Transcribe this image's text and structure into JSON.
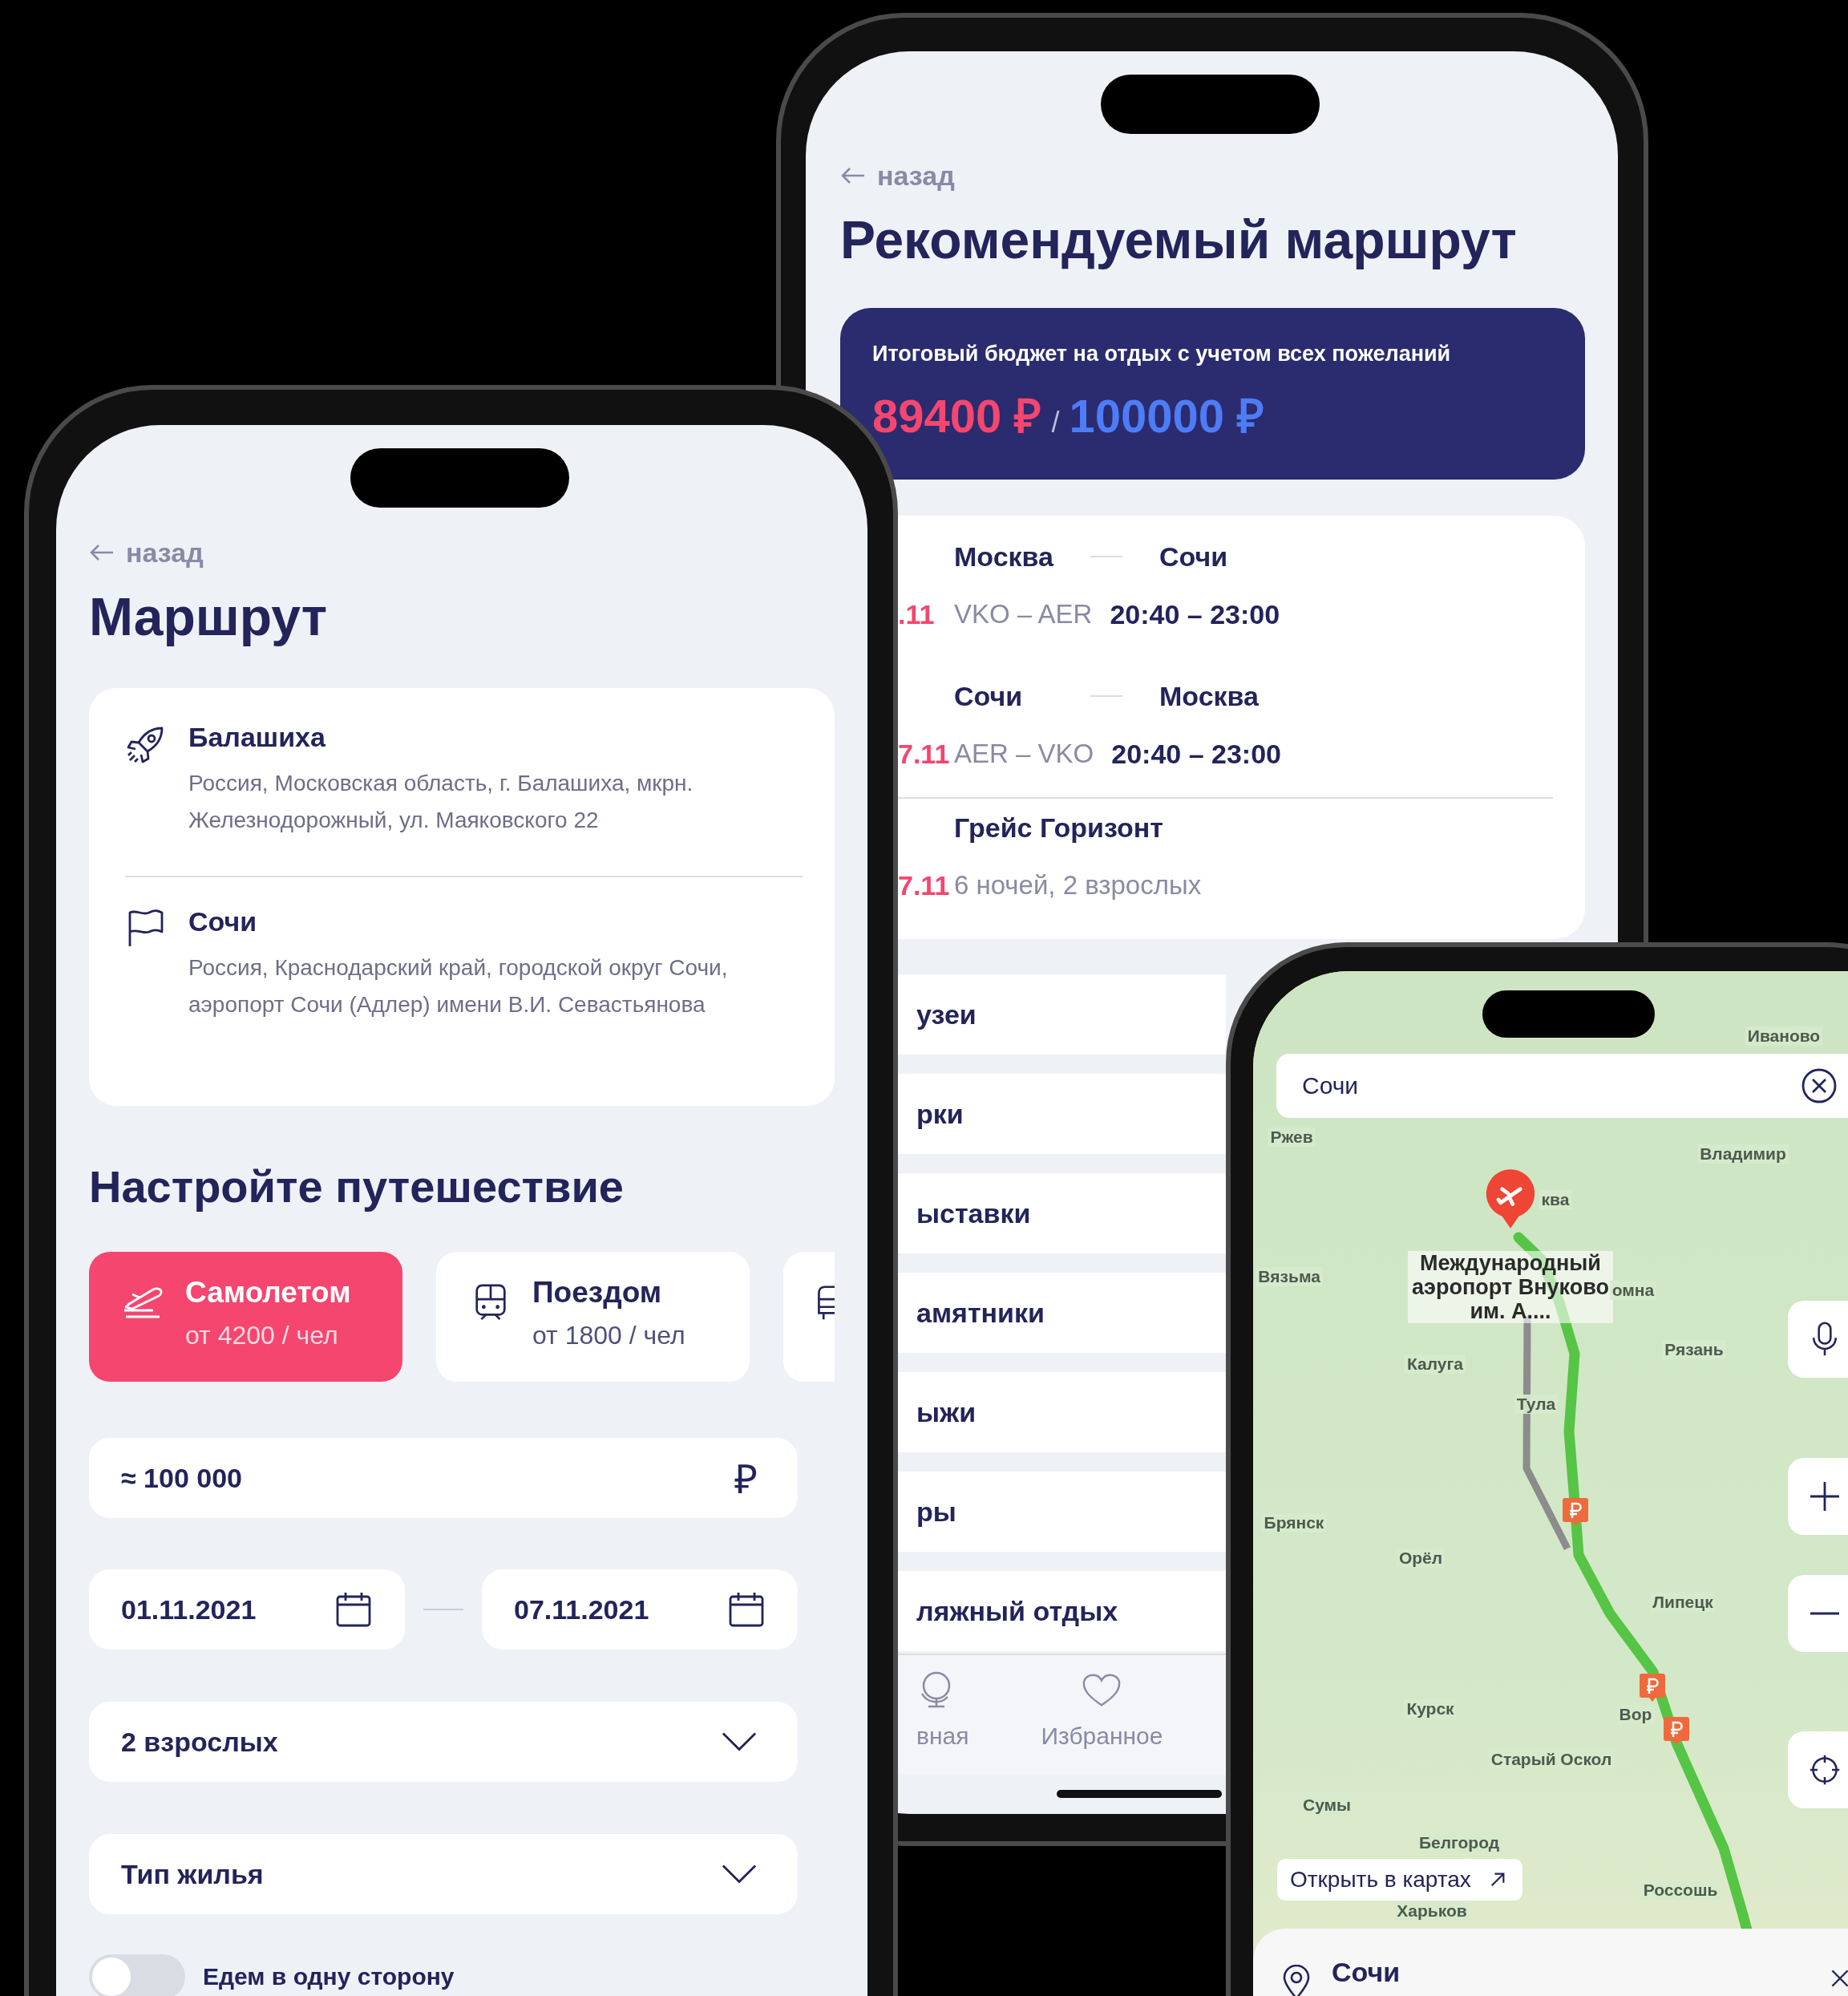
{
  "route_screen": {
    "back_link": "назад",
    "title": "Маршрут",
    "places": [
      {
        "kind": "origin",
        "name": "Балашиха",
        "address": "Россия, Московская область, г. Балашиха, мкрн. Железнодорожный, ул. Маяковского 22"
      },
      {
        "kind": "destination",
        "name": "Сочи",
        "address": "Россия, Краснодарский край, городской округ Сочи, аэропорт Сочи (Адлер) имени В.И. Севастьянова"
      }
    ],
    "section_title": "Настройте путешествие",
    "transport": [
      {
        "kind": "plane",
        "label": "Самолетом",
        "price": "от 4200 / чел",
        "selected": true
      },
      {
        "kind": "train",
        "label": "Поездом",
        "price": "от 1800 / чел",
        "selected": false
      },
      {
        "kind": "bus",
        "selected": false
      }
    ],
    "budget_field": {
      "value": "≈ 100 000",
      "currency": "₽"
    },
    "date_from": "01.11.2021",
    "date_to": "07.11.2021",
    "travelers_select": "2 взрослых",
    "housing_select": {
      "placeholder": "Тип жилья"
    },
    "one_way_toggle": {
      "label": "Едем в одну сторону",
      "on": false
    }
  },
  "recommended_screen": {
    "back_link": "назад",
    "title": "Рекомендуемый маршрут",
    "budget": {
      "caption": "Итоговый бюджет на отдых с учетом всех пожеланий",
      "spent": "89400 ₽",
      "separator": "/",
      "total": "100000 ₽"
    },
    "trip": [
      {
        "kind": "flight",
        "date": ".11",
        "from": "Москва",
        "to": "Сочи",
        "airports": "VKO – AER",
        "time": "20:40 – 23:00"
      },
      {
        "kind": "flight",
        "date": "7.11",
        "from": "Сочи",
        "to": "Москва",
        "airports": "AER – VKO",
        "time": "20:40 – 23:00"
      },
      {
        "kind": "hotel",
        "date": "7.11",
        "name": "Грейс Горизонт",
        "details": "6 ночей, 2 взрослых"
      }
    ],
    "categories": [
      "узеи",
      "рки",
      "ыставки",
      "амятники",
      "ыжи",
      "ры",
      "ляжный отдых"
    ],
    "tab_bar": [
      {
        "kind": "globe",
        "label": "вная"
      },
      {
        "kind": "heart",
        "label": "Избранное"
      }
    ]
  },
  "map_screen": {
    "search": {
      "value": "Сочи"
    },
    "map_labels": [
      "Иваново",
      "Ржев",
      "Владимир",
      "ква",
      "Вязьма",
      "Международный аэропорт Внуково им. А....",
      "омна",
      "Рязань",
      "Калуга",
      "Тула",
      "Брянск",
      "Орёл",
      "Липецк",
      "Курск",
      "Вор",
      "Старый Оскол",
      "Сумы",
      "Белгород",
      "Харьков",
      "Россошь"
    ],
    "open_in_maps": "Открыть в картах",
    "result": {
      "title": "Сочи"
    }
  }
}
